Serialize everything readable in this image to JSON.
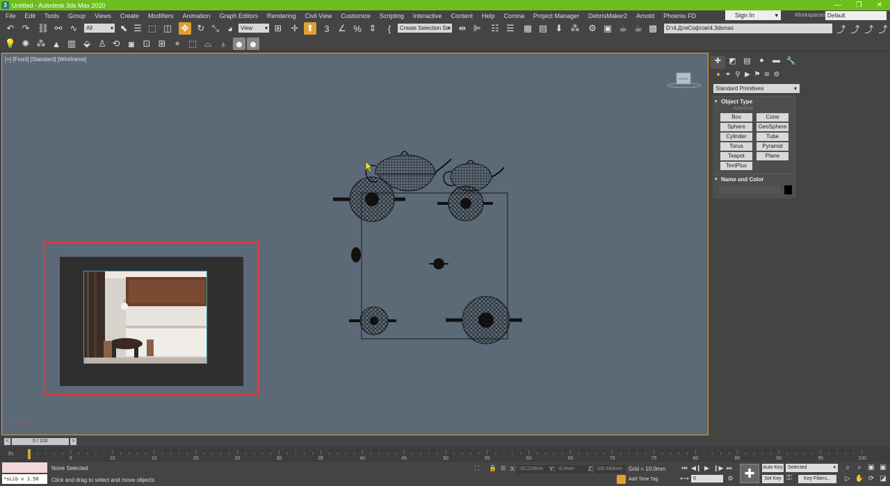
{
  "window": {
    "title": "Untitled - Autodesk 3ds Max 2020",
    "app_icon": "3",
    "controls": [
      "—",
      "❐",
      "✕"
    ]
  },
  "menu": [
    "File",
    "Edit",
    "Tools",
    "Group",
    "Views",
    "Create",
    "Modifiers",
    "Animation",
    "Graph Editors",
    "Rendering",
    "Civil View",
    "Customize",
    "Scripting",
    "Interactive",
    "Content",
    "Help",
    "Corona",
    "Project Manager",
    "DebrisMaker2",
    "Arnold",
    "Phoenix FD"
  ],
  "account": {
    "sign_in": "Sign In",
    "workspaces_label": "Workspaces:",
    "workspace": "Default"
  },
  "toolbar": {
    "filter": "All",
    "ref_coord": "View",
    "selection_set": "Create Selection Se",
    "project_path": "D:\\4.ДляСофтов\\4.3dsmax"
  },
  "viewport": {
    "label": "[+] [Front] [Standard] [Wireframe]",
    "viewcube_label": "FRONT"
  },
  "command_panel": {
    "category": "Standard Primitives",
    "object_type_title": "Object Type",
    "autogrid": "AutoGrid",
    "objects": [
      "Box",
      "Cone",
      "Sphere",
      "GeoSphere",
      "Cylinder",
      "Tube",
      "Torus",
      "Pyramid",
      "Teapot",
      "Plane",
      "TextPlus"
    ],
    "name_color_title": "Name and Color"
  },
  "timeline": {
    "frame_display": "0 / 100",
    "ticks": [
      "0",
      "5",
      "10",
      "15",
      "20",
      "25",
      "30",
      "35",
      "40",
      "45",
      "50",
      "55",
      "60",
      "65",
      "70",
      "75",
      "80",
      "85",
      "90",
      "95",
      "100"
    ]
  },
  "status": {
    "maxscript": "*sLib v 1.50",
    "selection": "None Selected",
    "prompt": "Click and drag to select and move objects",
    "x_label": "X:",
    "x_value": "-50.229mm",
    "y_label": "Y:",
    "y_value": "-0.0mm",
    "z_label": "Z:",
    "z_value": "100.583mm",
    "grid": "Grid = 10.0mm",
    "add_time_tag": "Add Time Tag",
    "auto_key": "Auto Key",
    "set_key": "Set Key",
    "selected_dd": "Selected",
    "key_filters": "Key Filters...",
    "current_frame": "0"
  }
}
